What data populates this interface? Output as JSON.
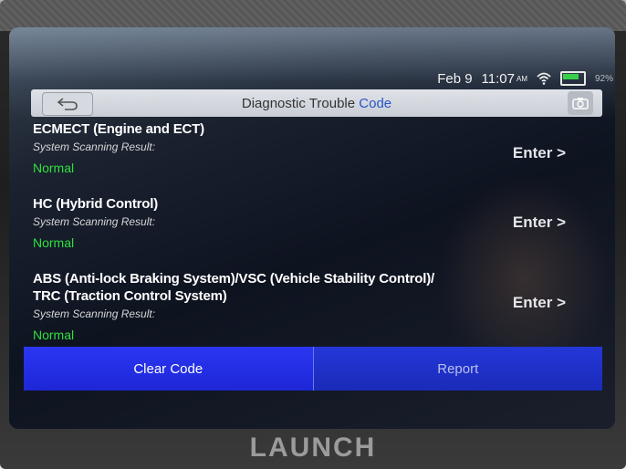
{
  "status_bar": {
    "date": "Feb 9",
    "time": "11:07",
    "ampm": "AM",
    "battery": "92%"
  },
  "header": {
    "title_prefix": "Diagnostic Trouble ",
    "title_accent": "Code"
  },
  "systems": [
    {
      "name": "ECMECT (Engine and ECT)",
      "result_label": "System Scanning Result:",
      "result": "Normal",
      "enter_label": "Enter >"
    },
    {
      "name": "HC (Hybrid Control)",
      "result_label": "System Scanning Result:",
      "result": "Normal",
      "enter_label": "Enter >"
    },
    {
      "name": "ABS (Anti-lock Braking System)/VSC (Vehicle Stability Control)/ TRC (Traction Control System)",
      "result_label": "System Scanning Result:",
      "result": "Normal",
      "enter_label": "Enter >"
    }
  ],
  "footer": {
    "clear_label": "Clear Code",
    "report_label": "Report"
  },
  "brand": "LAUNCH",
  "colors": {
    "accent_blue": "#1e27d6",
    "status_green": "#2fe03e"
  }
}
